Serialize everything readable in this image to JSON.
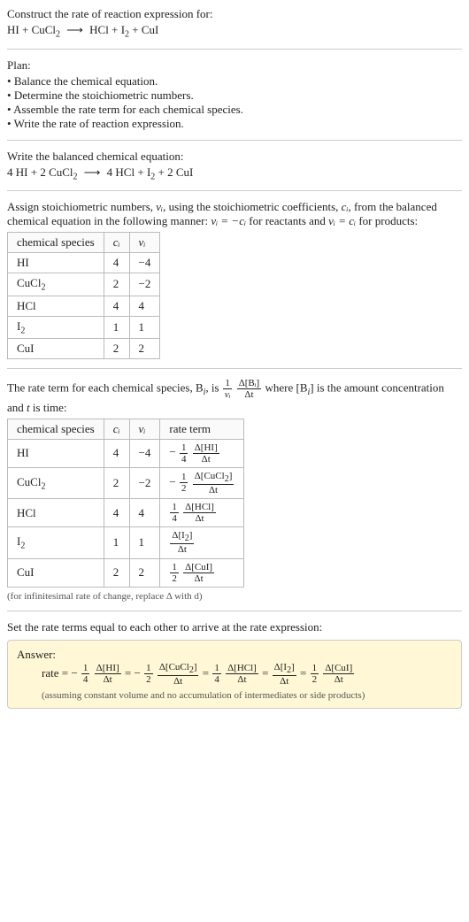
{
  "header": {
    "prompt": "Construct the rate of reaction expression for:",
    "equation_lhs_text": "HI + CuCl",
    "equation_rhs_text": "HCl + I",
    "plus_cui": " + CuI"
  },
  "plan": {
    "title": "Plan:",
    "items": [
      "Balance the chemical equation.",
      "Determine the stoichiometric numbers.",
      "Assemble the rate term for each chemical species.",
      "Write the rate of reaction expression."
    ]
  },
  "balanced": {
    "title": "Write the balanced chemical equation:",
    "c_hi": "4",
    "c_cucl2": "2",
    "c_hcl": "4",
    "c_i2": "",
    "c_cui": "2"
  },
  "assign": {
    "text_a": "Assign stoichiometric numbers, ",
    "text_b": ", using the stoichiometric coefficients, ",
    "text_c": ", from the balanced chemical equation in the following manner: ",
    "text_d": " for reactants and ",
    "text_e": " for products:",
    "nu": "ν",
    "nu_i": "νᵢ",
    "c": "c",
    "c_i": "cᵢ",
    "eq_react": "νᵢ = −cᵢ",
    "eq_prod": "νᵢ = cᵢ",
    "headers": {
      "species": "chemical species",
      "ci": "cᵢ",
      "vi": "νᵢ"
    },
    "rows": [
      {
        "name": "HI",
        "ci": "4",
        "vi": "−4"
      },
      {
        "name": "CuCl₂",
        "ci": "2",
        "vi": "−2"
      },
      {
        "name": "HCl",
        "ci": "4",
        "vi": "4"
      },
      {
        "name": "I₂",
        "ci": "1",
        "vi": "1"
      },
      {
        "name": "CuI",
        "ci": "2",
        "vi": "2"
      }
    ]
  },
  "rateterm": {
    "intro_a": "The rate term for each chemical species, B",
    "intro_b": ", is ",
    "intro_c": " where [B",
    "intro_d": "] is the amount concentration and ",
    "intro_e": " is time:",
    "t": "t",
    "i": "i",
    "frac1_num": "1",
    "frac1_den": "νᵢ",
    "frac2_num": "Δ[Bᵢ]",
    "frac2_den": "Δt",
    "headers": {
      "species": "chemical species",
      "ci": "cᵢ",
      "vi": "νᵢ",
      "rate": "rate term"
    },
    "rows": [
      {
        "name": "HI",
        "ci": "4",
        "vi": "−4",
        "sign": "−",
        "coef_num": "1",
        "coef_den": "4",
        "d_num": "Δ[HI]",
        "d_den": "Δt"
      },
      {
        "name": "CuCl₂",
        "ci": "2",
        "vi": "−2",
        "sign": "−",
        "coef_num": "1",
        "coef_den": "2",
        "d_num": "Δ[CuCl₂]",
        "d_den": "Δt"
      },
      {
        "name": "HCl",
        "ci": "4",
        "vi": "4",
        "sign": "",
        "coef_num": "1",
        "coef_den": "4",
        "d_num": "Δ[HCl]",
        "d_den": "Δt"
      },
      {
        "name": "I₂",
        "ci": "1",
        "vi": "1",
        "sign": "",
        "coef_num": "",
        "coef_den": "",
        "d_num": "Δ[I₂]",
        "d_den": "Δt"
      },
      {
        "name": "CuI",
        "ci": "2",
        "vi": "2",
        "sign": "",
        "coef_num": "1",
        "coef_den": "2",
        "d_num": "Δ[CuI]",
        "d_den": "Δt"
      }
    ],
    "note": "(for infinitesimal rate of change, replace Δ with d)"
  },
  "final": {
    "intro": "Set the rate terms equal to each other to arrive at the rate expression:",
    "answer_label": "Answer:",
    "rate_label": "rate = ",
    "terms": [
      {
        "sign": "−",
        "coef_num": "1",
        "coef_den": "4",
        "d_num": "Δ[HI]",
        "d_den": "Δt"
      },
      {
        "sign": "−",
        "coef_num": "1",
        "coef_den": "2",
        "d_num": "Δ[CuCl₂]",
        "d_den": "Δt"
      },
      {
        "sign": "",
        "coef_num": "1",
        "coef_den": "4",
        "d_num": "Δ[HCl]",
        "d_den": "Δt"
      },
      {
        "sign": "",
        "coef_num": "",
        "coef_den": "",
        "d_num": "Δ[I₂]",
        "d_den": "Δt"
      },
      {
        "sign": "",
        "coef_num": "1",
        "coef_den": "2",
        "d_num": "Δ[CuI]",
        "d_den": "Δt"
      }
    ],
    "eq": " = ",
    "assume": "(assuming constant volume and no accumulation of intermediates or side products)"
  }
}
